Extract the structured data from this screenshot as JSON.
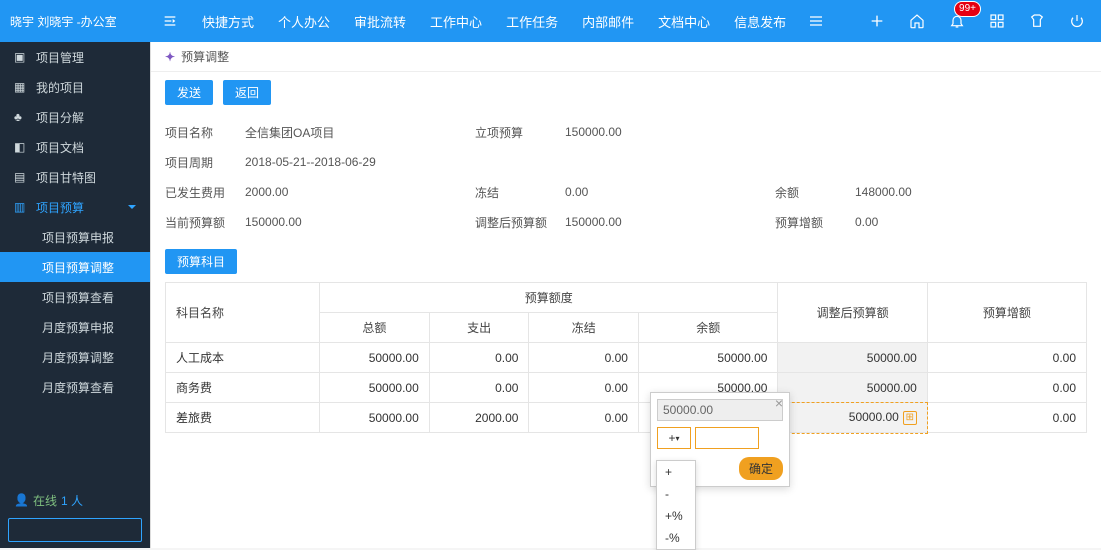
{
  "header": {
    "user_label": "晓宇  刘晓宇 -办公室",
    "nav": [
      "快捷方式",
      "个人办公",
      "审批流转",
      "工作中心",
      "工作任务",
      "内部邮件",
      "文档中心",
      "信息发布"
    ],
    "badge": "99+"
  },
  "sidebar": {
    "items": [
      {
        "label": "项目管理",
        "icon": "folder-icon"
      },
      {
        "label": "我的项目",
        "icon": "grid-icon"
      },
      {
        "label": "项目分解",
        "icon": "tree-icon"
      },
      {
        "label": "项目文档",
        "icon": "doc-icon"
      },
      {
        "label": "项目甘特图",
        "icon": "gantt-icon"
      },
      {
        "label": "项目预算",
        "icon": "budget-icon"
      }
    ],
    "subitems": [
      "项目预算申报",
      "项目预算调整",
      "项目预算查看",
      "月度预算申报",
      "月度预算调整",
      "月度预算查看"
    ],
    "online_label": "在线",
    "online_count": "1 人"
  },
  "crumb": {
    "title": "预算调整"
  },
  "actions": {
    "send": "发送",
    "back": "返回"
  },
  "info": {
    "r1": {
      "l1": "项目名称",
      "v1": "全信集团OA项目",
      "l2": "立项预算",
      "v2": "150000.00"
    },
    "r2": {
      "l1": "项目周期",
      "v1": "2018-05-21--2018-06-29"
    },
    "r3": {
      "l1": "已发生费用",
      "v1": "2000.00",
      "l2": "冻结",
      "v2": "0.00",
      "l3": "余额",
      "v3": "148000.00"
    },
    "r4": {
      "l1": "当前预算额",
      "v1": "150000.00",
      "l2": "调整后预算额",
      "v2": "150000.00",
      "l3": "预算增额",
      "v3": "0.00"
    }
  },
  "section_btn": "预算科目",
  "table": {
    "headers": {
      "subject": "科目名称",
      "group": "预算额度",
      "total": "总额",
      "spend": "支出",
      "freeze": "冻结",
      "balance": "余额",
      "adjusted": "调整后预算额",
      "delta": "预算增额"
    },
    "rows": [
      {
        "subject": "人工成本",
        "total": "50000.00",
        "spend": "0.00",
        "freeze": "0.00",
        "balance": "50000.00",
        "adjusted": "50000.00",
        "delta": "0.00"
      },
      {
        "subject": "商务费",
        "total": "50000.00",
        "spend": "0.00",
        "freeze": "0.00",
        "balance": "50000.00",
        "adjusted": "50000.00",
        "delta": "0.00"
      },
      {
        "subject": "差旅费",
        "total": "50000.00",
        "spend": "2000.00",
        "freeze": "0.00",
        "balance": "",
        "adjusted": "50000.00",
        "delta": "0.00"
      }
    ]
  },
  "popup": {
    "current": "50000.00",
    "op": "+",
    "confirm": "确定",
    "options": [
      "+",
      "-",
      "+%",
      "-%"
    ]
  }
}
